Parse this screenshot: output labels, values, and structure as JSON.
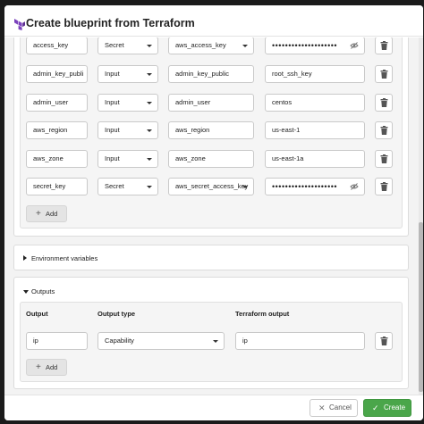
{
  "dialog": {
    "title": "Create blueprint from Terraform"
  },
  "variables": {
    "rows": [
      {
        "name": "access_key",
        "type": "Secret",
        "value": "aws_access_key",
        "input": "••••••••••••••••••••"
      },
      {
        "name": "admin_key_publi",
        "type": "Input",
        "value": "admin_key_public",
        "input": "root_ssh_key"
      },
      {
        "name": "admin_user",
        "type": "Input",
        "value": "admin_user",
        "input": "centos"
      },
      {
        "name": "aws_region",
        "type": "Input",
        "value": "aws_region",
        "input": "us-east-1"
      },
      {
        "name": "aws_zone",
        "type": "Input",
        "value": "aws_zone",
        "input": "us-east-1a"
      },
      {
        "name": "secret_key",
        "type": "Secret",
        "value": "aws_secret_access_key",
        "input": "••••••••••••••••••••"
      }
    ],
    "add_label": "Add"
  },
  "environment": {
    "label": "Environment variables"
  },
  "outputs": {
    "label": "Outputs",
    "headers": {
      "output": "Output",
      "type": "Output type",
      "terraform": "Terraform output"
    },
    "rows": [
      {
        "output": "ip",
        "type": "Capability",
        "terraform": "ip"
      }
    ],
    "add_label": "Add"
  },
  "footer": {
    "cancel_label": "Cancel",
    "create_label": "Create"
  },
  "colors": {
    "accent": "#4aa64a",
    "logo": "#7b42bc"
  }
}
